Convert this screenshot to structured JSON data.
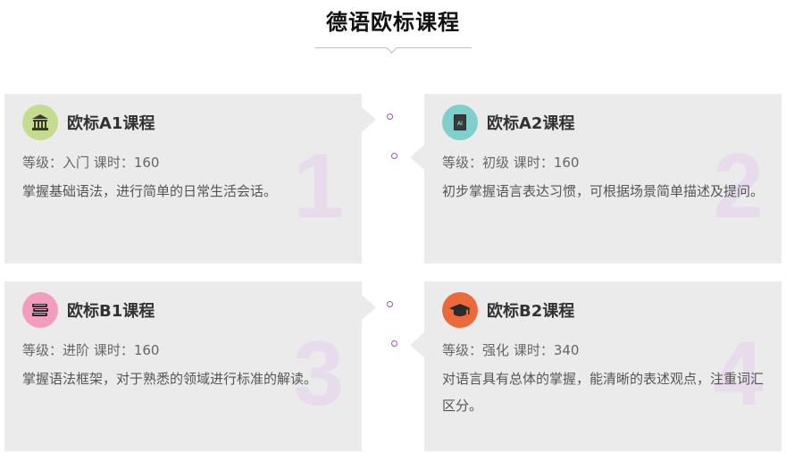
{
  "header": {
    "title": "德语欧标课程"
  },
  "courses": [
    {
      "title": "欧标A1课程",
      "level_label": "等级：",
      "level": "入门",
      "hours_label": "课时：",
      "hours": "160",
      "description": "掌握基础语法，进行简单的日常生活会话。",
      "number": "1",
      "icon": "bank-icon",
      "icon_color": "#c5dc8e"
    },
    {
      "title": "欧标A2课程",
      "level_label": "等级：",
      "level": "初级",
      "hours_label": "课时：",
      "hours": "160",
      "description": "初步掌握语言表达习惯，可根据场景简单描述及提问。",
      "number": "2",
      "icon": "book-icon",
      "icon_color": "#7fcfcc"
    },
    {
      "title": "欧标B1课程",
      "level_label": "等级：",
      "level": "进阶",
      "hours_label": "课时：",
      "hours": "160",
      "description": "掌握语法框架，对于熟悉的领域进行标准的解读。",
      "number": "3",
      "icon": "books-stack-icon",
      "icon_color": "#f29cc0"
    },
    {
      "title": "欧标B2课程",
      "level_label": "等级：",
      "level": "强化",
      "hours_label": "课时：",
      "hours": "340",
      "description": "对语言具有总体的掌握，能清晰的表述观点，注重词汇区分。",
      "number": "4",
      "icon": "graduation-cap-icon",
      "icon_color": "#ec6a3a"
    }
  ],
  "colors": {
    "card_bg": "#ebebeb",
    "dot": "#a94fc0",
    "number": "#e8dcec"
  }
}
